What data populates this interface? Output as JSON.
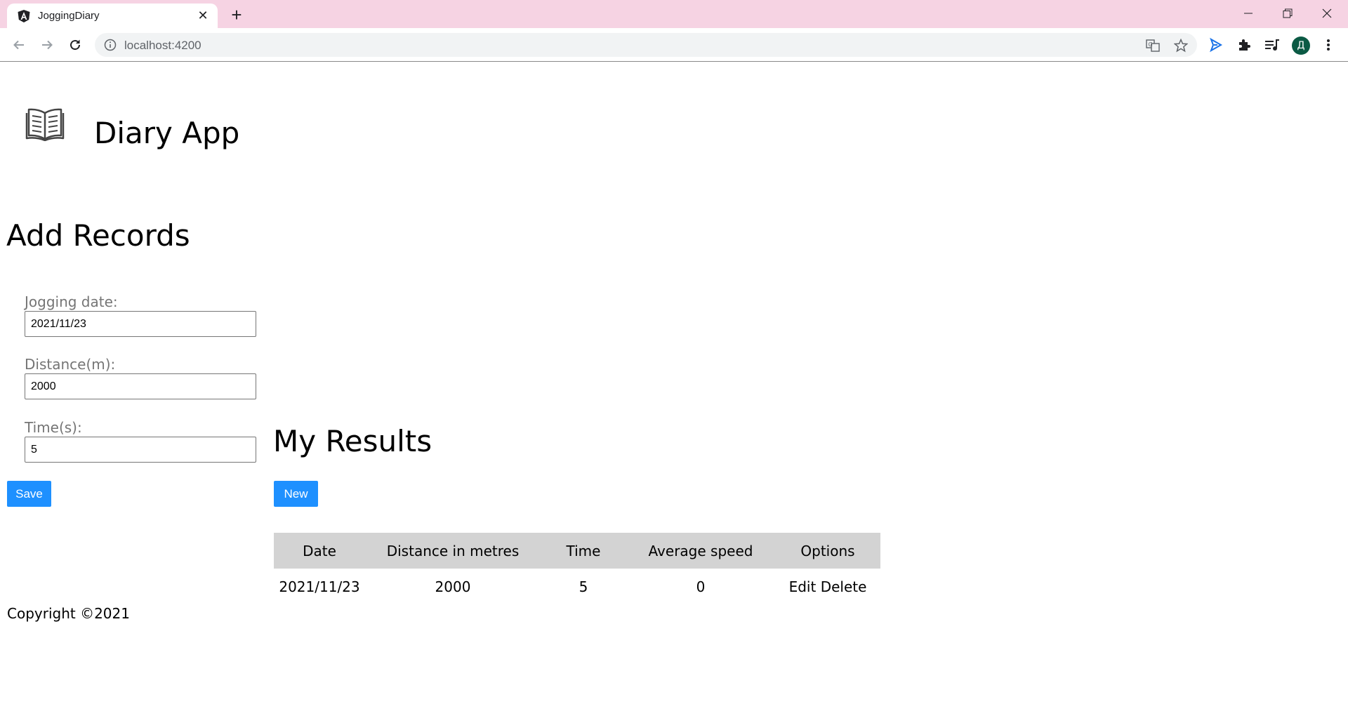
{
  "browser": {
    "tab_title": "JoggingDiary",
    "url": "localhost:4200",
    "avatar_letter": "Д"
  },
  "app": {
    "title": "Diary App"
  },
  "add_records": {
    "title": "Add Records",
    "date_label": "Jogging date:",
    "date_value": "2021/11/23",
    "distance_label": "Distance(m):",
    "distance_value": "2000",
    "time_label": "Time(s):",
    "time_value": "5",
    "save_label": "Save"
  },
  "results": {
    "title": "My Results",
    "new_label": "New",
    "columns": [
      "Date",
      "Distance in metres",
      "Time",
      "Average speed",
      "Options"
    ],
    "rows": [
      {
        "date": "2021/11/23",
        "distance": "2000",
        "time": "5",
        "speed": "0",
        "edit": "Edit",
        "delete": "Delete"
      }
    ]
  },
  "footer": {
    "text": "Copyright ©2021"
  },
  "colors": {
    "tabstrip": "#f6d3e3",
    "button": "#1e90ff",
    "table_header": "#d3d3d3",
    "avatar": "#0b5a44"
  }
}
